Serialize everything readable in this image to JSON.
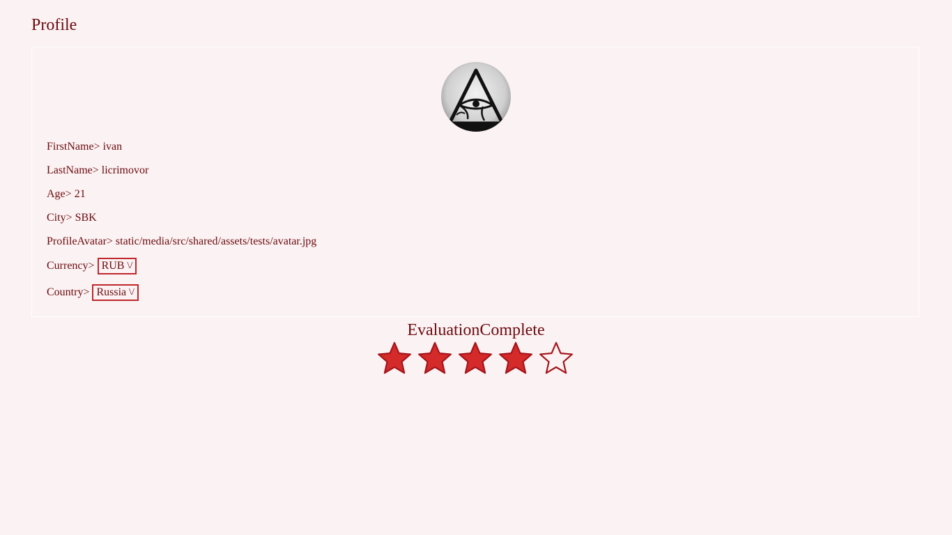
{
  "page": {
    "title": "Profile"
  },
  "profile": {
    "first_name_label": "FirstName>",
    "first_name": "ivan",
    "last_name_label": "LastName>",
    "last_name": "licrimovor",
    "age_label": "Age>",
    "age": "21",
    "city_label": "City>",
    "city": "SBK",
    "avatar_label": "ProfileAvatar>",
    "avatar_path": "static/media/src/shared/assets/tests/avatar.jpg",
    "currency_label": "Currency>",
    "currency": "RUB",
    "country_label": "Country>",
    "country": "Russia",
    "dropdown_glyph": "\\/"
  },
  "evaluation": {
    "label": "EvaluationComplete",
    "rating": 4,
    "max": 5
  },
  "colors": {
    "background": "#fbf2f3",
    "text": "#6b0a0e",
    "accent": "#c0262c",
    "star_fill": "#d42a2a",
    "star_stroke": "#a5151b"
  }
}
